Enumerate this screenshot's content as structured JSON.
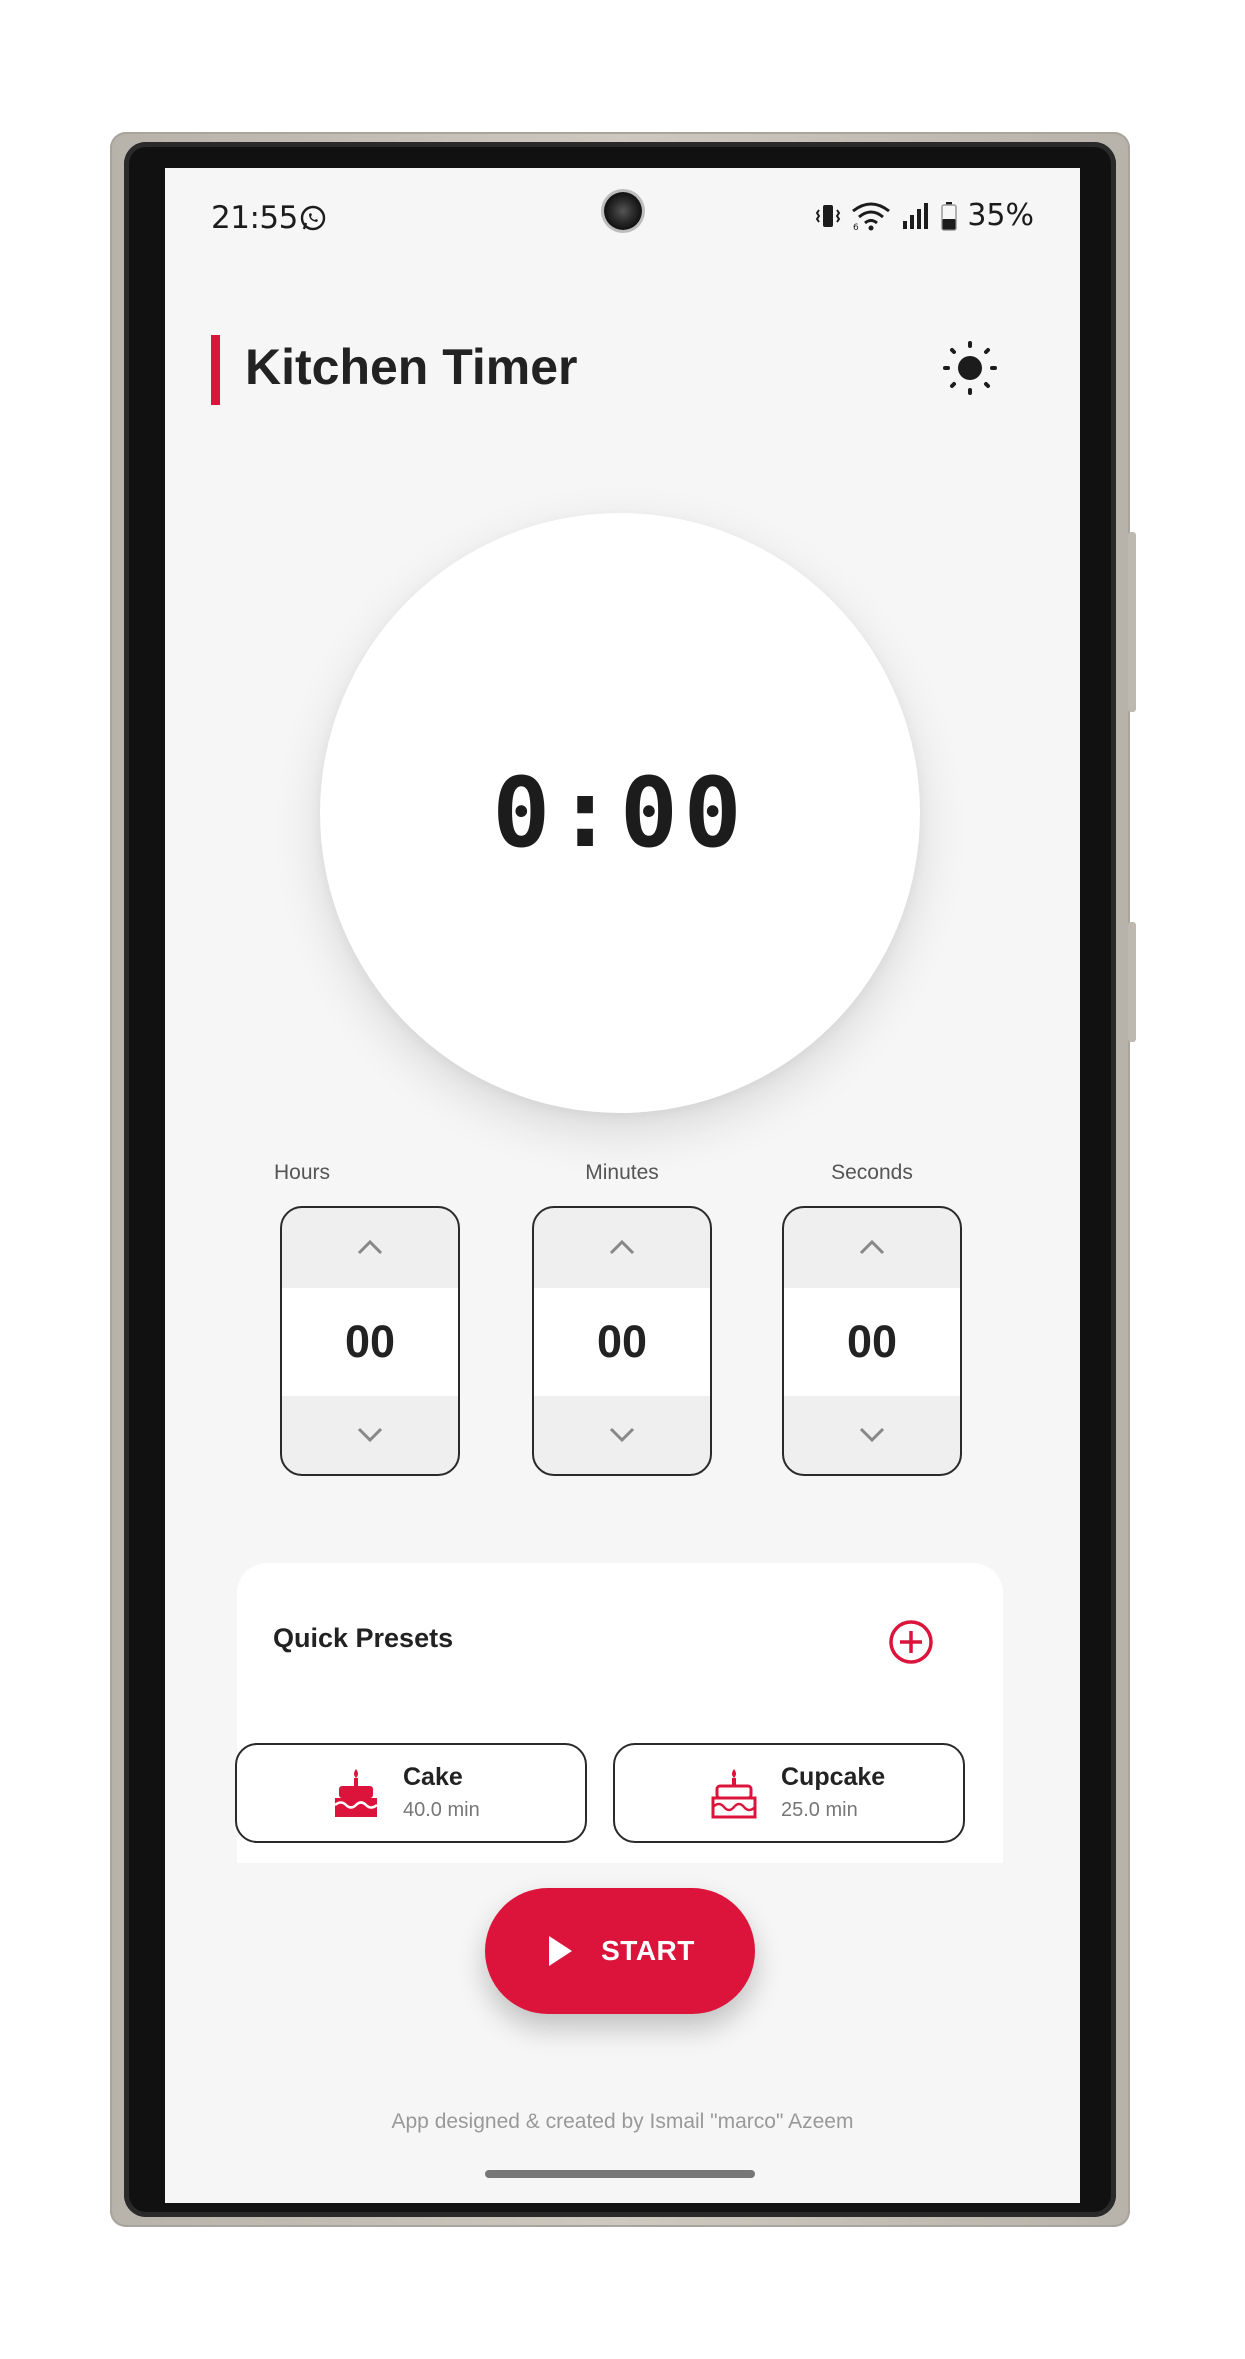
{
  "status_bar": {
    "time": "21:55",
    "battery": "35%",
    "icons": [
      "whatsapp-icon",
      "vibrate-icon",
      "wifi-icon",
      "signal-icon",
      "battery-icon"
    ]
  },
  "header": {
    "title": "Kitchen Timer",
    "theme_icon": "sun-icon"
  },
  "timer": {
    "display": "0:00"
  },
  "pickers": [
    {
      "label": "Hours",
      "value": "00"
    },
    {
      "label": "Minutes",
      "value": "00"
    },
    {
      "label": "Seconds",
      "value": "00"
    }
  ],
  "presets": {
    "title": "Quick Presets",
    "add_icon": "add-circle-icon",
    "items": [
      {
        "name": "Cake",
        "time": "40.0 min",
        "icon": "cake-icon"
      },
      {
        "name": "Cupcake",
        "time": "25.0 min",
        "icon": "cupcake-icon"
      }
    ]
  },
  "start": {
    "label": "START",
    "icon": "play-icon"
  },
  "footer": {
    "credit": "App designed & created by Ismail \"marco\" Azeem"
  },
  "colors": {
    "accent": "#dc143c",
    "background": "#f6f6f6",
    "text": "#222222"
  }
}
